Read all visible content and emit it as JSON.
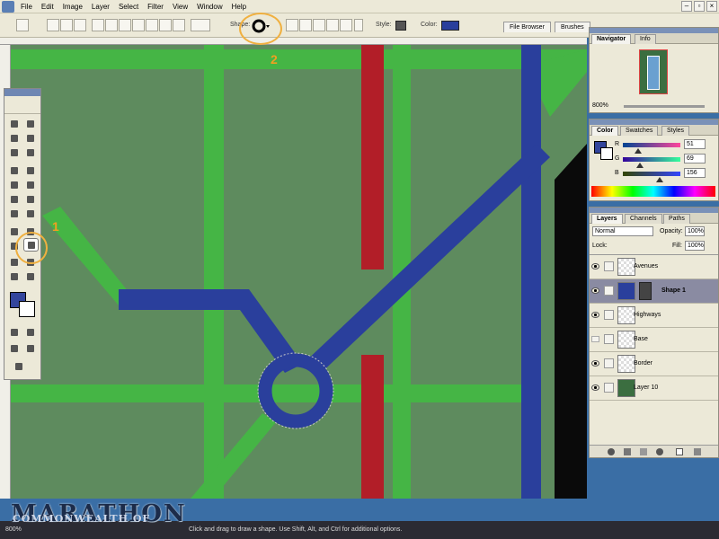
{
  "menubar": {
    "items": [
      "File",
      "Edit",
      "Image",
      "Layer",
      "Select",
      "Filter",
      "View",
      "Window",
      "Help"
    ]
  },
  "options_bar": {
    "shape_label": "Shape:",
    "style_label": "Style:",
    "color_label": "Color:",
    "color_value": "#2a3f9c",
    "tabs": [
      "File Browser",
      "Brushes"
    ]
  },
  "navigator": {
    "tabs": [
      "Navigator",
      "Info"
    ],
    "zoom": "800%"
  },
  "color_panel": {
    "tabs": [
      "Color",
      "Swatches",
      "Styles"
    ],
    "channels": [
      {
        "label": "R",
        "value": "51"
      },
      {
        "label": "G",
        "value": "69"
      },
      {
        "label": "B",
        "value": "156"
      }
    ],
    "foreground": "#33459c"
  },
  "layers_panel": {
    "tabs": [
      "Layers",
      "Channels",
      "Paths"
    ],
    "blend_mode": "Normal",
    "opacity_label": "Opacity:",
    "opacity_value": "100%",
    "lock_label": "Lock:",
    "fill_label": "Fill:",
    "fill_value": "100%",
    "layers": [
      {
        "name": "Avenues",
        "visible": true,
        "selected": false
      },
      {
        "name": "Shape 1",
        "visible": true,
        "selected": true
      },
      {
        "name": "Highways",
        "visible": true,
        "selected": false
      },
      {
        "name": "Base",
        "visible": false,
        "selected": false
      },
      {
        "name": "Border",
        "visible": true,
        "selected": false
      },
      {
        "name": "Layer 10",
        "visible": true,
        "selected": false
      }
    ]
  },
  "status": {
    "zoom": "800%",
    "hint": "Click and drag to draw a shape. Use Shift, Alt, and Ctrl for additional options."
  },
  "callouts": {
    "one": "1",
    "two": "2"
  },
  "brand": {
    "title": "MARATHON",
    "subtitle": "COMMONWEALTH OF"
  },
  "colors": {
    "canvas_bg": "#5e8b5e",
    "street_green": "#45b545",
    "highway_red": "#b21e28",
    "avenue_blue": "#2a3f9c"
  }
}
